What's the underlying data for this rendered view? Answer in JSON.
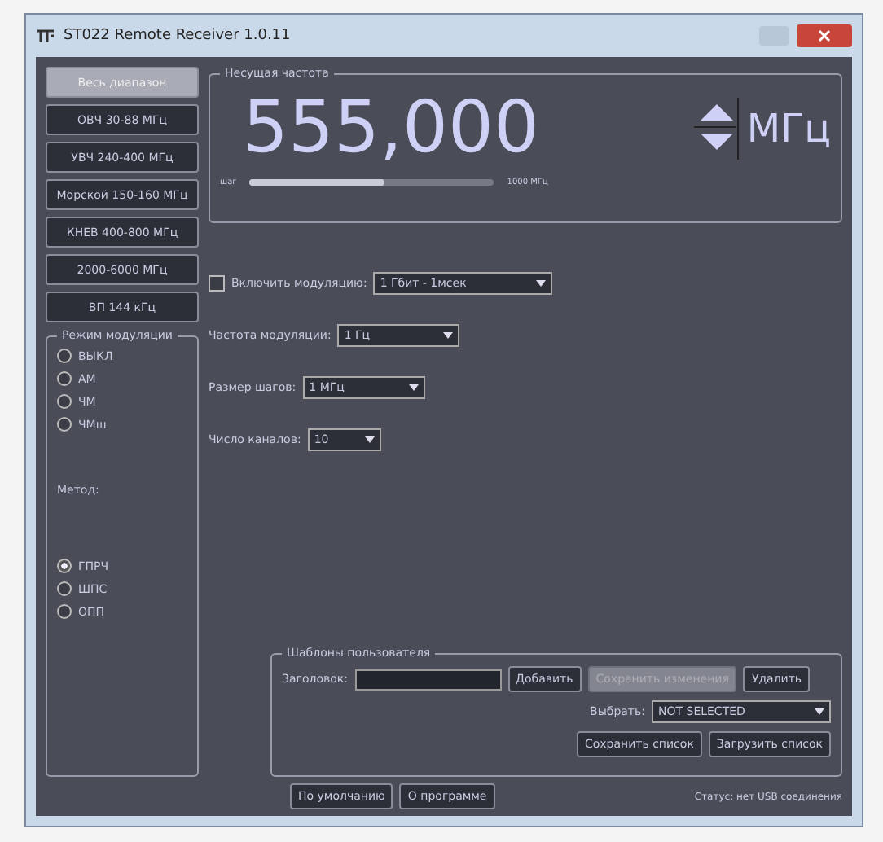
{
  "window": {
    "title": "ST022 Remote Receiver 1.0.11"
  },
  "bands": [
    {
      "label": "Весь диапазон",
      "selected": true
    },
    {
      "label": "ОВЧ 30-88 МГц",
      "selected": false
    },
    {
      "label": "УВЧ 240-400 МГц",
      "selected": false
    },
    {
      "label": "Морской 150-160 МГц",
      "selected": false
    },
    {
      "label": "КНЕВ 400-800 МГц",
      "selected": false
    },
    {
      "label": "2000-6000 МГц",
      "selected": false
    },
    {
      "label": "ВП 144 кГц",
      "selected": false
    }
  ],
  "modulation_mode": {
    "title": "Режим модуляции",
    "options": [
      {
        "label": "ВЫКЛ",
        "selected": false
      },
      {
        "label": "АМ",
        "selected": false
      },
      {
        "label": "ЧМ",
        "selected": false
      },
      {
        "label": "ЧМш",
        "selected": false
      }
    ],
    "method_label": "Метод:",
    "methods": [
      {
        "label": "ГПРЧ",
        "selected": true
      },
      {
        "label": "ШПС",
        "selected": false
      },
      {
        "label": "ОПП",
        "selected": false
      }
    ]
  },
  "frequency": {
    "title": "Несущая частота",
    "value": "555,000",
    "unit": "МГц",
    "slider": {
      "min_label": "шаг",
      "max_label": "1000 МГц",
      "level": 0.55
    }
  },
  "modulation": {
    "label": "Включить модуляцию:",
    "checked": false,
    "value": "1 Гбит - 1мсек"
  },
  "settings": [
    {
      "label": "Частота модуляции:",
      "value": "1 Гц"
    },
    {
      "label": "Размер шагов:",
      "value": "1 МГц"
    },
    {
      "label": "Число каналов:",
      "value": "10"
    }
  ],
  "templates": {
    "title": "Шаблоны пользователя",
    "name_label": "Заголовок:",
    "add": "Добавить",
    "save_changes": "Сохранить изменения",
    "save_disabled": true,
    "delete": "Удалить",
    "select_label": "Выбрать:",
    "select_value": "NOT SELECTED",
    "save_list": "Сохранить список",
    "load_list": "Загрузить список"
  },
  "footer": {
    "defaults": "По умолчанию",
    "about": "О программе",
    "status": "Статус: нет USB соединения"
  }
}
